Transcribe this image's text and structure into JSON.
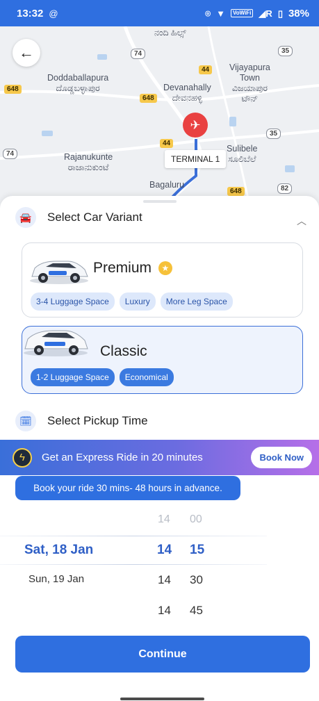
{
  "status_bar": {
    "time": "13:32",
    "battery": "38%",
    "wifi_label": "Wi-Fi"
  },
  "map": {
    "places": [
      {
        "id": "nandi",
        "text": "ನಂದಿ ಹಿಲ್ಸ್"
      },
      {
        "id": "doddaballapura",
        "text": "Doddaballapura\nದೊಡ್ಡಬಳ್ಳಾಪುರ"
      },
      {
        "id": "devanahally",
        "text": "Devanahally\nದೇವನಹಳ್ಳಿ"
      },
      {
        "id": "vijayapura",
        "text": "Vijayapura\nTown\nವಿಜಯಾಪುರ\nಟೌನ್"
      },
      {
        "id": "rajanukunte",
        "text": "Rajanukunte\nರಾಜಾನುಕುಂಟೆ"
      },
      {
        "id": "sulibele",
        "text": "Sulibele\nಸೂಲಿಬೆಲೆ"
      },
      {
        "id": "bagaluru",
        "text": "Bagaluru"
      }
    ],
    "roads": [
      "74",
      "44",
      "35",
      "648",
      "648",
      "35",
      "44",
      "74",
      "648",
      "82"
    ],
    "terminal_label": "TERMINAL 1"
  },
  "car_section": {
    "title": "Select Car Variant",
    "variants": [
      {
        "name": "Premium",
        "chips": [
          "3-4 Luggage Space",
          "Luxury",
          "More Leg Space"
        ]
      },
      {
        "name": "Classic",
        "chips": [
          "1-2 Luggage Space",
          "Economical"
        ]
      }
    ]
  },
  "pickup_section": {
    "title": "Select Pickup Time"
  },
  "express": {
    "text": "Get an Express Ride in 20 minutes",
    "button": "Book Now"
  },
  "tooltip": "Book your ride 30 mins- 48 hours in advance.",
  "picker": {
    "days": [
      "Sat, 18 Jan",
      "Sun, 19 Jan"
    ],
    "hours": [
      "14",
      "14",
      "14",
      "14"
    ],
    "minutes": [
      "00",
      "15",
      "30",
      "45"
    ],
    "selected": {
      "day": "Sat, 18 Jan",
      "hour": "14",
      "minute": "15"
    }
  },
  "continue_label": "Continue",
  "colors": {
    "primary": "#2f6fe0",
    "accent_gold": "#f6c13a",
    "pin_red": "#e94141"
  }
}
